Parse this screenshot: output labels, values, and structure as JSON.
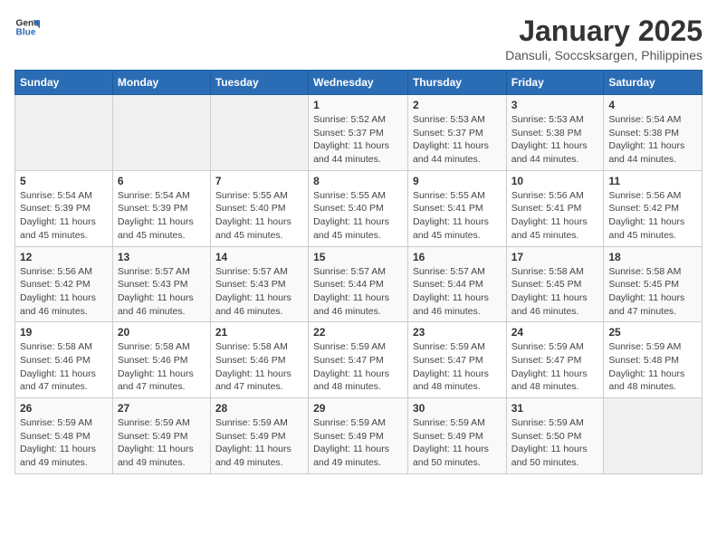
{
  "logo": {
    "general": "General",
    "blue": "Blue"
  },
  "title": "January 2025",
  "subtitle": "Dansuli, Soccsksargen, Philippines",
  "days_of_week": [
    "Sunday",
    "Monday",
    "Tuesday",
    "Wednesday",
    "Thursday",
    "Friday",
    "Saturday"
  ],
  "weeks": [
    [
      {
        "day": "",
        "empty": true
      },
      {
        "day": "",
        "empty": true
      },
      {
        "day": "",
        "empty": true
      },
      {
        "day": "1",
        "sunrise": "5:52 AM",
        "sunset": "5:37 PM",
        "daylight": "11 hours and 44 minutes."
      },
      {
        "day": "2",
        "sunrise": "5:53 AM",
        "sunset": "5:37 PM",
        "daylight": "11 hours and 44 minutes."
      },
      {
        "day": "3",
        "sunrise": "5:53 AM",
        "sunset": "5:38 PM",
        "daylight": "11 hours and 44 minutes."
      },
      {
        "day": "4",
        "sunrise": "5:54 AM",
        "sunset": "5:38 PM",
        "daylight": "11 hours and 44 minutes."
      }
    ],
    [
      {
        "day": "5",
        "sunrise": "5:54 AM",
        "sunset": "5:39 PM",
        "daylight": "11 hours and 45 minutes."
      },
      {
        "day": "6",
        "sunrise": "5:54 AM",
        "sunset": "5:39 PM",
        "daylight": "11 hours and 45 minutes."
      },
      {
        "day": "7",
        "sunrise": "5:55 AM",
        "sunset": "5:40 PM",
        "daylight": "11 hours and 45 minutes."
      },
      {
        "day": "8",
        "sunrise": "5:55 AM",
        "sunset": "5:40 PM",
        "daylight": "11 hours and 45 minutes."
      },
      {
        "day": "9",
        "sunrise": "5:55 AM",
        "sunset": "5:41 PM",
        "daylight": "11 hours and 45 minutes."
      },
      {
        "day": "10",
        "sunrise": "5:56 AM",
        "sunset": "5:41 PM",
        "daylight": "11 hours and 45 minutes."
      },
      {
        "day": "11",
        "sunrise": "5:56 AM",
        "sunset": "5:42 PM",
        "daylight": "11 hours and 45 minutes."
      }
    ],
    [
      {
        "day": "12",
        "sunrise": "5:56 AM",
        "sunset": "5:42 PM",
        "daylight": "11 hours and 46 minutes."
      },
      {
        "day": "13",
        "sunrise": "5:57 AM",
        "sunset": "5:43 PM",
        "daylight": "11 hours and 46 minutes."
      },
      {
        "day": "14",
        "sunrise": "5:57 AM",
        "sunset": "5:43 PM",
        "daylight": "11 hours and 46 minutes."
      },
      {
        "day": "15",
        "sunrise": "5:57 AM",
        "sunset": "5:44 PM",
        "daylight": "11 hours and 46 minutes."
      },
      {
        "day": "16",
        "sunrise": "5:57 AM",
        "sunset": "5:44 PM",
        "daylight": "11 hours and 46 minutes."
      },
      {
        "day": "17",
        "sunrise": "5:58 AM",
        "sunset": "5:45 PM",
        "daylight": "11 hours and 46 minutes."
      },
      {
        "day": "18",
        "sunrise": "5:58 AM",
        "sunset": "5:45 PM",
        "daylight": "11 hours and 47 minutes."
      }
    ],
    [
      {
        "day": "19",
        "sunrise": "5:58 AM",
        "sunset": "5:46 PM",
        "daylight": "11 hours and 47 minutes."
      },
      {
        "day": "20",
        "sunrise": "5:58 AM",
        "sunset": "5:46 PM",
        "daylight": "11 hours and 47 minutes."
      },
      {
        "day": "21",
        "sunrise": "5:58 AM",
        "sunset": "5:46 PM",
        "daylight": "11 hours and 47 minutes."
      },
      {
        "day": "22",
        "sunrise": "5:59 AM",
        "sunset": "5:47 PM",
        "daylight": "11 hours and 48 minutes."
      },
      {
        "day": "23",
        "sunrise": "5:59 AM",
        "sunset": "5:47 PM",
        "daylight": "11 hours and 48 minutes."
      },
      {
        "day": "24",
        "sunrise": "5:59 AM",
        "sunset": "5:47 PM",
        "daylight": "11 hours and 48 minutes."
      },
      {
        "day": "25",
        "sunrise": "5:59 AM",
        "sunset": "5:48 PM",
        "daylight": "11 hours and 48 minutes."
      }
    ],
    [
      {
        "day": "26",
        "sunrise": "5:59 AM",
        "sunset": "5:48 PM",
        "daylight": "11 hours and 49 minutes."
      },
      {
        "day": "27",
        "sunrise": "5:59 AM",
        "sunset": "5:49 PM",
        "daylight": "11 hours and 49 minutes."
      },
      {
        "day": "28",
        "sunrise": "5:59 AM",
        "sunset": "5:49 PM",
        "daylight": "11 hours and 49 minutes."
      },
      {
        "day": "29",
        "sunrise": "5:59 AM",
        "sunset": "5:49 PM",
        "daylight": "11 hours and 49 minutes."
      },
      {
        "day": "30",
        "sunrise": "5:59 AM",
        "sunset": "5:49 PM",
        "daylight": "11 hours and 50 minutes."
      },
      {
        "day": "31",
        "sunrise": "5:59 AM",
        "sunset": "5:50 PM",
        "daylight": "11 hours and 50 minutes."
      },
      {
        "day": "",
        "empty": true
      }
    ]
  ],
  "labels": {
    "sunrise": "Sunrise:",
    "sunset": "Sunset:",
    "daylight": "Daylight:"
  }
}
